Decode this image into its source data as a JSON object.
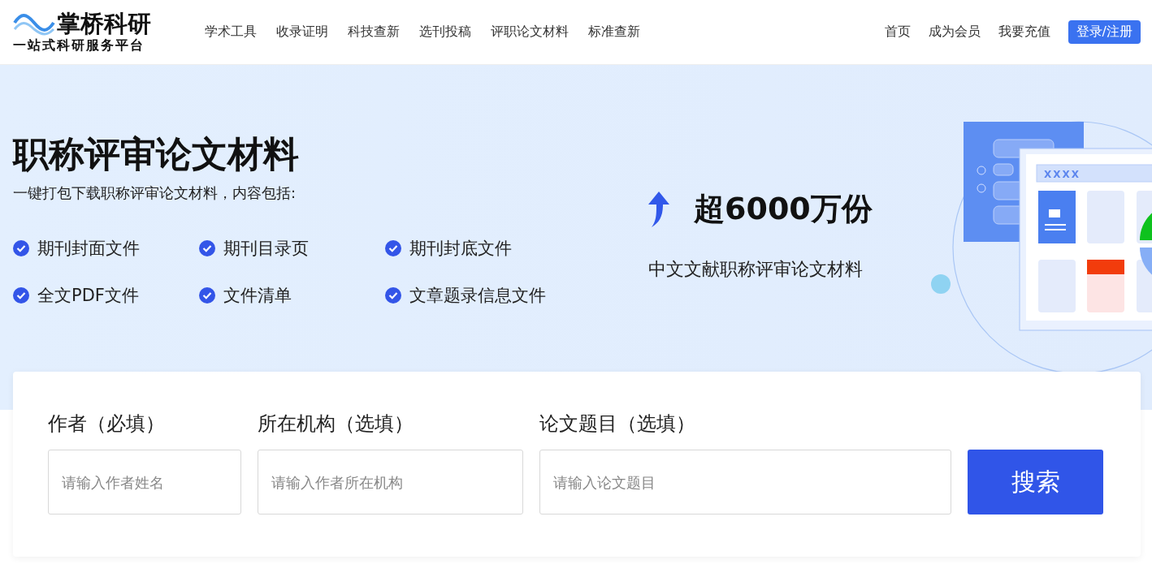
{
  "header": {
    "logo_title": "掌桥科研",
    "logo_subtitle": "一站式科研服务平台",
    "nav": [
      "学术工具",
      "收录证明",
      "科技查新",
      "选刊投稿",
      "评职论文材料",
      "标准查新"
    ],
    "links": [
      "首页",
      "成为会员",
      "我要充值"
    ],
    "login": "登录/注册"
  },
  "hero": {
    "title": "职称评审论文材料",
    "subtitle": "一键打包下载职称评审论文材料，内容包括:",
    "features": [
      {
        "label": "期刊封面文件",
        "checked": true
      },
      {
        "label": "期刊目录页",
        "checked": true
      },
      {
        "label": "期刊封底文件",
        "checked": true
      },
      {
        "label": "全文PDF文件",
        "checked": true
      },
      {
        "label": "文件清单",
        "checked": true
      },
      {
        "label": "文章题录信息文件",
        "checked": true
      }
    ],
    "stat": "超6000万份",
    "stat_caption": "中文文献职称评审论文材料",
    "illustration_label": "XXXX"
  },
  "search": {
    "fields": [
      {
        "label": "作者（必填）",
        "placeholder": "请输入作者姓名"
      },
      {
        "label": "所在机构（选填）",
        "placeholder": "请输入作者所在机构"
      },
      {
        "label": "论文题目（选填）",
        "placeholder": "请输入论文题目"
      }
    ],
    "button": "搜索"
  }
}
